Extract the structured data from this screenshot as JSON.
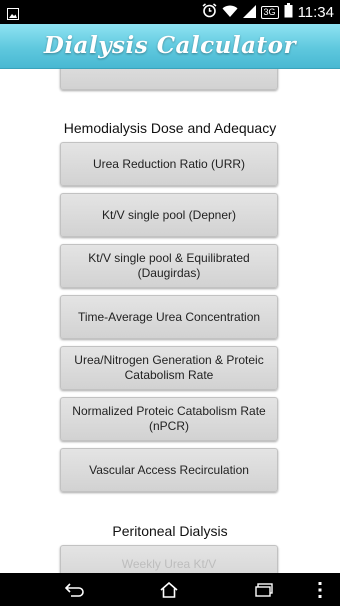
{
  "status_bar": {
    "time": "11:34",
    "network_badge": "3G",
    "icons": [
      "image-icon",
      "alarm-icon",
      "wifi-icon",
      "signal-icon",
      "battery-icon"
    ]
  },
  "app": {
    "title": "Dialysis Calculator",
    "title_bar_color": "#5fc8de"
  },
  "sections": {
    "hemodialysis_title": "Hemodialysis Dose and Adequacy",
    "peritoneal_title": "Peritoneal Dialysis"
  },
  "buttons": {
    "top_partial": "",
    "urr": "Urea Reduction Ratio (URR)",
    "ktv_single": "Kt/V single pool (Depner)",
    "ktv_equil": "Kt/V single pool & Equilibrated (Daugirdas)",
    "tac": "Time-Average Urea Concentration",
    "ungpcr": "Urea/Nitrogen Generation & Proteic Catabolism Rate",
    "npcr": "Normalized Proteic Catabolism Rate (nPCR)",
    "recirc": "Vascular Access Recirculation",
    "weekly_ktv": "Weekly Urea Kt/V"
  },
  "nav_bar": {
    "icons": [
      "back-icon",
      "home-icon",
      "recent-apps-icon",
      "overflow-menu-icon"
    ]
  }
}
